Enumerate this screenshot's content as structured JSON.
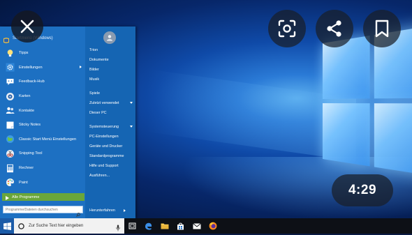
{
  "start_menu": {
    "header_label": "Startmenü (Windows)",
    "programs": [
      {
        "label": "Tipps",
        "icon": "lightbulb-icon",
        "has_submenu": false
      },
      {
        "label": "Einstellungen",
        "icon": "gear-icon",
        "has_submenu": true
      },
      {
        "label": "Feedback-Hub",
        "icon": "feedback-icon",
        "has_submenu": false
      },
      {
        "label": "Karten",
        "icon": "camera-icon",
        "has_submenu": false
      },
      {
        "label": "Kontakte",
        "icon": "contacts-icon",
        "has_submenu": false
      },
      {
        "label": "Sticky Notes",
        "icon": "sticky-notes-icon",
        "has_submenu": false
      },
      {
        "label": "Classic Start Menü Einstellungen",
        "icon": "globe-icon",
        "has_submenu": false
      },
      {
        "label": "Snipping Tool",
        "icon": "scissors-icon",
        "has_submenu": false
      },
      {
        "label": "Rechner",
        "icon": "calculator-icon",
        "has_submenu": false
      },
      {
        "label": "Paint",
        "icon": "paint-icon",
        "has_submenu": false
      }
    ],
    "all_programs_label": "Alle Programme",
    "search_placeholder": "Programme/Dateien durchsuchen",
    "places_group1": [
      {
        "label": "Trion",
        "arrow": ""
      },
      {
        "label": "Dokumente",
        "arrow": ""
      },
      {
        "label": "Bilder",
        "arrow": ""
      },
      {
        "label": "Musik",
        "arrow": ""
      }
    ],
    "places_group2": [
      {
        "label": "Spiele",
        "arrow": ""
      },
      {
        "label": "Zuletzt verwendet",
        "arrow": "down"
      },
      {
        "label": "Dieser PC",
        "arrow": ""
      }
    ],
    "places_group3": [
      {
        "label": "Systemsteuerung",
        "arrow": "down"
      },
      {
        "label": "PC-Einstellungen",
        "arrow": ""
      },
      {
        "label": "Geräte und Drucker",
        "arrow": ""
      },
      {
        "label": "Standardprogramme",
        "arrow": ""
      },
      {
        "label": "Hilfe und Support",
        "arrow": ""
      },
      {
        "label": "Ausführen...",
        "arrow": ""
      }
    ],
    "shutdown_label": "Herunterfahren"
  },
  "taskbar": {
    "search_placeholder": "Zur Suche Text hier eingeben",
    "pinned": [
      "task-view-icon",
      "edge-icon",
      "file-explorer-icon",
      "store-icon",
      "mail-icon",
      "firefox-icon"
    ]
  },
  "overlay": {
    "timer": "4:29"
  },
  "colors": {
    "menu_left": "#1d70c2",
    "menu_right": "#1565b3",
    "all_programs_bg": "#6aa63a",
    "taskbar": "#0d1016"
  }
}
